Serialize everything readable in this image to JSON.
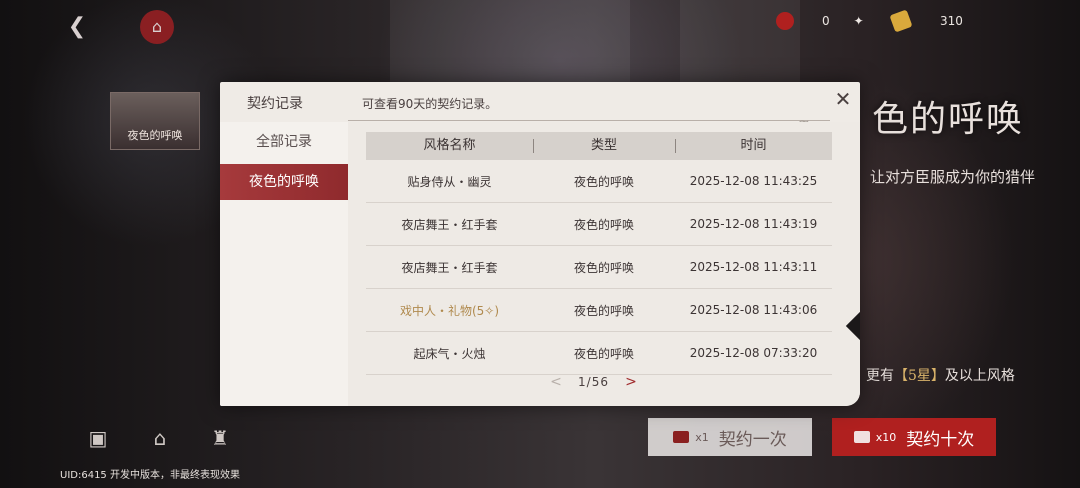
{
  "background": {
    "currencies": [
      {
        "icon": "dice-icon",
        "value": "0",
        "color": "#b0201f"
      },
      {
        "icon": "gold-bar-icon",
        "value": "310",
        "color": "#d9a93c"
      }
    ],
    "small_banner_text": "夜色的呼唤",
    "big_title": "色的呼唤",
    "big_subtitle": "让对方臣服成为你的猎伴",
    "rule_prefix": "更有",
    "rule_highlight": "【5星】",
    "rule_suffix": "及以上风格",
    "btn_one": {
      "cost": "x1",
      "label": "契约一次"
    },
    "btn_ten": {
      "cost": "x10",
      "label": "契约十次"
    },
    "uid_text": "UID:6415   开发中版本，非最终表现效果"
  },
  "modal": {
    "title": "契约记录",
    "description": "可查看90天的契约记录。",
    "close_glyph": "✕",
    "sidebar": [
      {
        "label": "全部记录",
        "active": false
      },
      {
        "label": "夜色的呼唤",
        "active": true
      }
    ],
    "table": {
      "headers": [
        "风格名称",
        "类型",
        "时间"
      ],
      "rows": [
        {
          "name": "贴身侍从・幽灵",
          "type": "夜色的呼唤",
          "time": "2025-12-08 11:43:25",
          "highlight": false
        },
        {
          "name": "夜店舞王・红手套",
          "type": "夜色的呼唤",
          "time": "2025-12-08 11:43:19",
          "highlight": false
        },
        {
          "name": "夜店舞王・红手套",
          "type": "夜色的呼唤",
          "time": "2025-12-08 11:43:11",
          "highlight": false
        },
        {
          "name": "戏中人・礼物(5✧)",
          "type": "夜色的呼唤",
          "time": "2025-12-08 11:43:06",
          "highlight": true
        },
        {
          "name": "起床气・火烛",
          "type": "夜色的呼唤",
          "time": "2025-12-08 07:33:20",
          "highlight": false
        }
      ]
    },
    "pagination": {
      "current": "1",
      "total": "56",
      "separator": "/",
      "prev_glyph": "<",
      "next_glyph": ">"
    }
  }
}
